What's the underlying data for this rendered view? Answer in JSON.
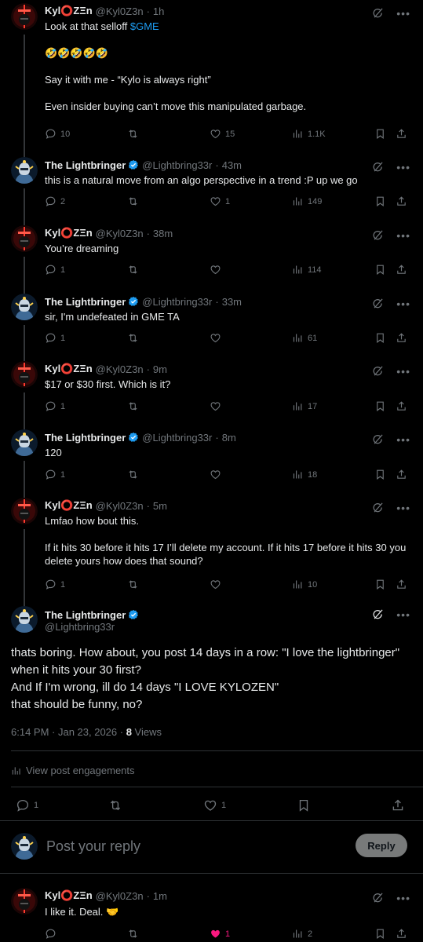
{
  "posts": [
    {
      "name": "Kyl⭕ZΞn",
      "handle": "@Kyl0Z3n",
      "time": "1h",
      "lines": [
        "Look at that selloff ",
        "$GME",
        "🤣🤣🤣🤣🤣",
        "Say it with me - “Kylo is always right”",
        "Even insider buying can’t move this manipulated garbage."
      ],
      "replies": "10",
      "reposts": "",
      "likes": "15",
      "views": "1.1K"
    },
    {
      "name": "The Lightbringer",
      "handle": "@Lightbring33r",
      "time": "43m",
      "lines": [
        "this is a natural move from an algo perspective in a trend :P up we go"
      ],
      "replies": "2",
      "reposts": "",
      "likes": "1",
      "views": "149"
    },
    {
      "name": "Kyl⭕ZΞn",
      "handle": "@Kyl0Z3n",
      "time": "38m",
      "lines": [
        "You’re dreaming"
      ],
      "replies": "1",
      "reposts": "",
      "likes": "",
      "views": "114"
    },
    {
      "name": "The Lightbringer",
      "handle": "@Lightbring33r",
      "time": "33m",
      "lines": [
        "sir, I'm undefeated in GME TA"
      ],
      "replies": "1",
      "reposts": "",
      "likes": "",
      "views": "61"
    },
    {
      "name": "Kyl⭕ZΞn",
      "handle": "@Kyl0Z3n",
      "time": "9m",
      "lines": [
        "$17 or $30 first.  Which is it?"
      ],
      "replies": "1",
      "reposts": "",
      "likes": "",
      "views": "17"
    },
    {
      "name": "The Lightbringer",
      "handle": "@Lightbring33r",
      "time": "8m",
      "lines": [
        "120"
      ],
      "replies": "1",
      "reposts": "",
      "likes": "",
      "views": "18"
    },
    {
      "name": "Kyl⭕ZΞn",
      "handle": "@Kyl0Z3n",
      "time": "5m",
      "lines": [
        "Lmfao how bout this.",
        "If it hits 30 before it hits 17 I’ll delete my account. If it hits 17 before it hits 30 you delete yours how does that sound?"
      ],
      "replies": "1",
      "reposts": "",
      "likes": "",
      "views": "10"
    }
  ],
  "main_post": {
    "name": "The Lightbringer",
    "handle": "@Lightbring33r",
    "lines": [
      "thats boring. How about, you post 14 days in a row: \"I love the lightbringer\" when it hits your 30 first?",
      "And If I'm wrong, ill do 14 days \"I LOVE KYLOZEN\"",
      "that should be funny, no?"
    ],
    "timestamp": "6:14 PM · Jan 23, 2026 · ",
    "views_count": "8",
    "views_label": " Views",
    "engagements": "View post engagements",
    "replies": "1",
    "reposts": "",
    "likes": "1"
  },
  "reply_box": {
    "placeholder": "Post your reply",
    "button": "Reply"
  },
  "last_post": {
    "name": "Kyl⭕ZΞn",
    "handle": "@Kyl0Z3n",
    "time": "1m",
    "lines": [
      "I like it.  Deal. 🤝"
    ],
    "replies": "",
    "reposts": "",
    "likes": "1",
    "views": "2"
  },
  "sep": "·",
  "colors": {
    "accent": "#1d9bf0",
    "like": "#f91880",
    "muted": "#71767b"
  }
}
